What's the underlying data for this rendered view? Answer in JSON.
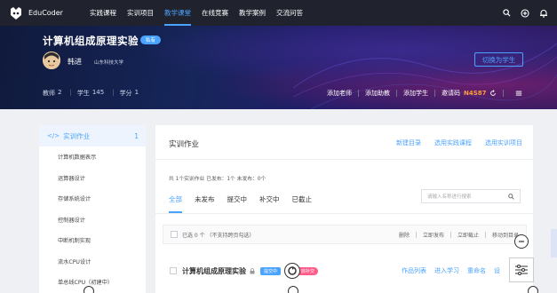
{
  "topbar": {
    "logo_text": "EduCoder",
    "nav": [
      "实践课程",
      "实训项目",
      "教学课堂",
      "在线竞赛",
      "教学案例",
      "交流问答"
    ],
    "active_index": 2
  },
  "banner": {
    "course_title": "计算机组成原理实验",
    "course_tag": "私有",
    "teacher_name": "韩进",
    "school": "山东科技大学",
    "switch_label": "切换为学生",
    "stats": [
      {
        "label": "教师",
        "value": "2"
      },
      {
        "label": "学生",
        "value": "145"
      },
      {
        "label": "学分",
        "value": "1"
      }
    ],
    "actions": [
      "添加老师",
      "添加助教",
      "添加学生"
    ],
    "invite_label": "邀请码",
    "invite_code": "N4S87"
  },
  "sidebar": {
    "head_label": "实训作业",
    "head_count": "1",
    "items": [
      "计算机数据表示",
      "运算器设计",
      "存储系统设计",
      "控制器设计",
      "中断机制实现",
      "流水CPU设计",
      "单总线CPU（初建中）"
    ]
  },
  "main": {
    "title": "实训作业",
    "top_links": [
      "新建目录",
      "选用实践课程",
      "选用实训项目"
    ],
    "summary": "共 1个实训作业    已发布：1个    未发布：0个",
    "tabs": [
      "全部",
      "未发布",
      "提交中",
      "补交中",
      "已截止"
    ],
    "active_tab": 0,
    "search_placeholder": "请输入名称进行搜索",
    "selected_text": "已选 0 个 （不支持跨页勾选）",
    "bulk_actions": [
      "删除",
      "立即发布",
      "立即截止",
      "移动到目录"
    ],
    "row": {
      "title": "计算机组成原理实验",
      "status": "提交中",
      "badge": "开启补交",
      "links": [
        "作品列表",
        "进入学习",
        "重命名",
        "设"
      ]
    }
  },
  "colors": {
    "accent": "#4aa3ff",
    "topbar": "#20232d",
    "invite_code": "#ff9c3a",
    "badge_pink": "#ff5c8a"
  }
}
